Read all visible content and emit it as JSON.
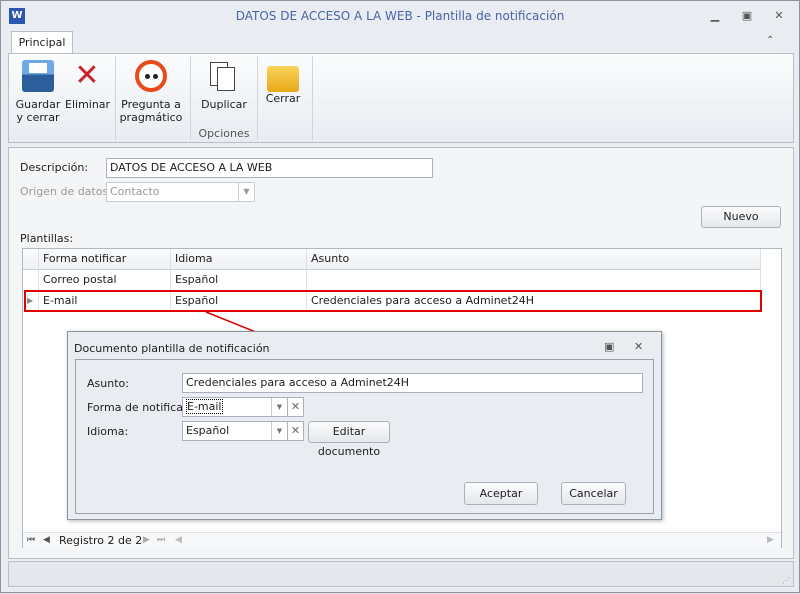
{
  "window": {
    "title": "DATOS DE ACCESO A LA WEB - Plantilla de notificación",
    "app_icon": "word-icon"
  },
  "ribbon": {
    "tab": "Principal",
    "buttons": [
      {
        "label1": "Guardar",
        "label2": "y cerrar",
        "icon": "floppy-save-icon"
      },
      {
        "label1": "Eliminar",
        "label2": "",
        "icon": "red-x-icon"
      },
      {
        "label1": "Pregunta a",
        "label2": "pragmático",
        "icon": "robot-face-icon"
      },
      {
        "label1": "Duplicar",
        "label2": "",
        "icon": "copy-documents-icon"
      },
      {
        "label1": "Cerrar",
        "label2": "",
        "icon": "folder-exit-icon"
      }
    ],
    "group_label": "Opciones"
  },
  "form": {
    "descripcion_label": "Descripción:",
    "descripcion_value": "DATOS DE ACCESO A LA WEB",
    "origen_label": "Origen de datos:",
    "origen_value": "Contacto",
    "nuevo": "Nuevo",
    "plantillas_label": "Plantillas:"
  },
  "grid": {
    "columns": [
      "Forma notificar",
      "Idioma",
      "Asunto"
    ],
    "rows": [
      [
        "Correo postal",
        "Español",
        ""
      ],
      [
        "E-mail",
        "Español",
        "Credenciales para acceso a Adminet24H"
      ]
    ],
    "record_text": "Registro 2 de 2",
    "highlight_color": "#e00000"
  },
  "dialog": {
    "title": "Documento plantilla de notificación",
    "asunto_label": "Asunto:",
    "asunto_value": "Credenciales para acceso a Adminet24H",
    "forma_label": "Forma de notificar:",
    "forma_value": "E-mail",
    "idioma_label": "Idioma:",
    "idioma_value": "Español",
    "editar": "Editar documento",
    "aceptar": "Aceptar",
    "cancelar": "Cancelar"
  }
}
